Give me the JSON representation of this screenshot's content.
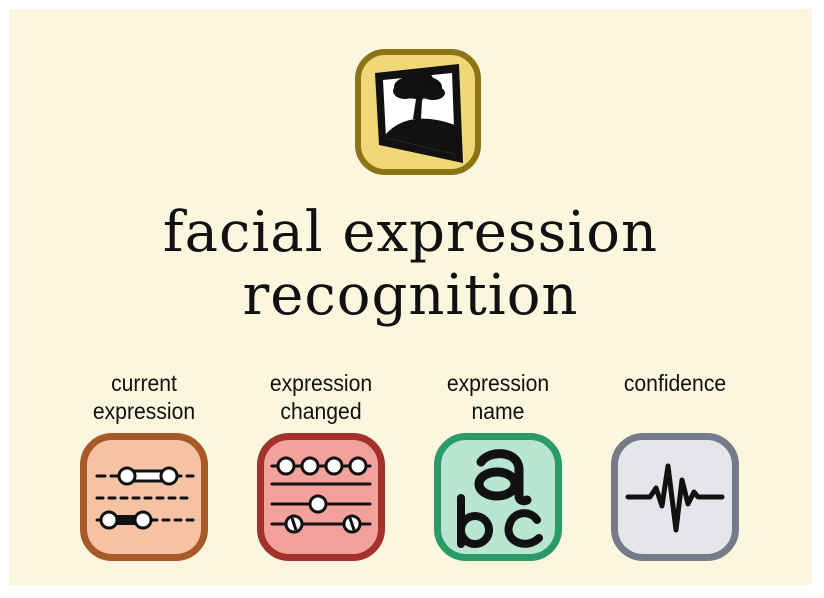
{
  "page": {
    "title_lines": [
      "facial expression",
      "recognition"
    ],
    "background": "#fbf6de"
  },
  "main_icon": {
    "icon": "tree-picture-icon",
    "border_color": "#8c7415",
    "fill_color": "#f0d877"
  },
  "blocks": [
    {
      "label_lines": [
        "current",
        "expression"
      ],
      "icon": "sliders-icon",
      "border_color": "#a65a28",
      "fill_color": "#f5c3a4"
    },
    {
      "label_lines": [
        "expression",
        "changed"
      ],
      "icon": "mixer-sliders-icon",
      "border_color": "#a5312c",
      "fill_color": "#f2a19c"
    },
    {
      "label_lines": [
        "expression",
        "name"
      ],
      "icon": "abc-text-icon",
      "border_color": "#2b9a69",
      "fill_color": "#b8e6d3"
    },
    {
      "label_lines": [
        "confidence"
      ],
      "icon": "waveform-icon",
      "border_color": "#767b8a",
      "fill_color": "#e5e6ea"
    }
  ]
}
